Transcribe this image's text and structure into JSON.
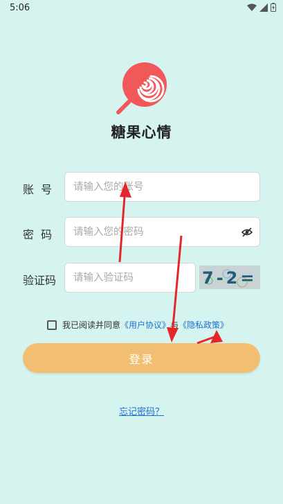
{
  "status_bar": {
    "time": "5:06"
  },
  "app": {
    "title": "糖果心情"
  },
  "form": {
    "account_label": "账  号",
    "account_placeholder": "请输入您的账号",
    "password_label": "密  码",
    "password_placeholder": "请输入您的密码",
    "captcha_label": "验证码",
    "captcha_placeholder": "请输入验证码",
    "captcha_text": "7-2="
  },
  "agreement": {
    "prefix": "我已阅读并同意",
    "user_agreement": "《用户协议》",
    "conjunction": "与",
    "privacy_policy": "《隐私政策》"
  },
  "login_button": "登录",
  "forgot_password": "忘记密码？",
  "colors": {
    "background": "#d5f4f0",
    "accent": "#f2bf72",
    "link": "#1e6fd0",
    "logo": "#f0585a",
    "annotation": "#e3262b"
  }
}
